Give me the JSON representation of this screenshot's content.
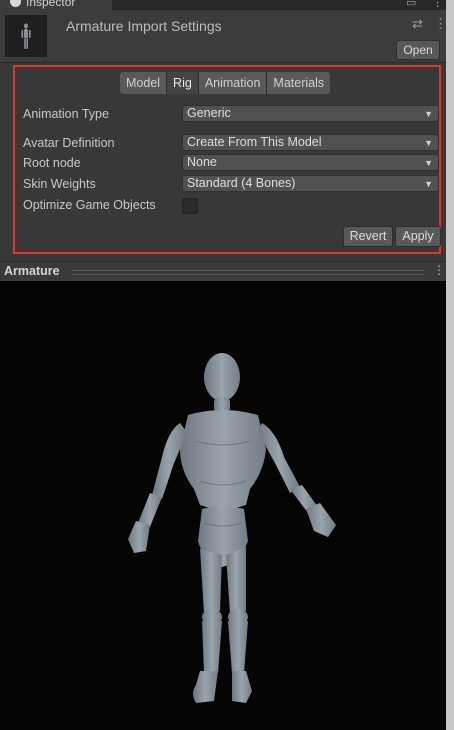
{
  "window": {
    "tab_label": "Inspector"
  },
  "header": {
    "title": "Armature Import Settings",
    "open_label": "Open"
  },
  "tabs": [
    {
      "label": "Model",
      "active": false
    },
    {
      "label": "Rig",
      "active": true
    },
    {
      "label": "Animation",
      "active": false
    },
    {
      "label": "Materials",
      "active": false
    }
  ],
  "rig": {
    "animation_type": {
      "label": "Animation Type",
      "value": "Generic"
    },
    "avatar_definition": {
      "label": "Avatar Definition",
      "value": "Create From This Model"
    },
    "root_node": {
      "label": "Root node",
      "value": "None"
    },
    "skin_weights": {
      "label": "Skin Weights",
      "value": "Standard (4 Bones)"
    },
    "optimize": {
      "label": "Optimize Game Objects",
      "checked": false
    }
  },
  "actions": {
    "revert_label": "Revert",
    "apply_label": "Apply"
  },
  "preview": {
    "title": "Armature"
  },
  "colors": {
    "highlight": "#d9382d",
    "panel_bg": "#383838",
    "viewport_bg": "#050505",
    "model": "#8f98a1"
  }
}
